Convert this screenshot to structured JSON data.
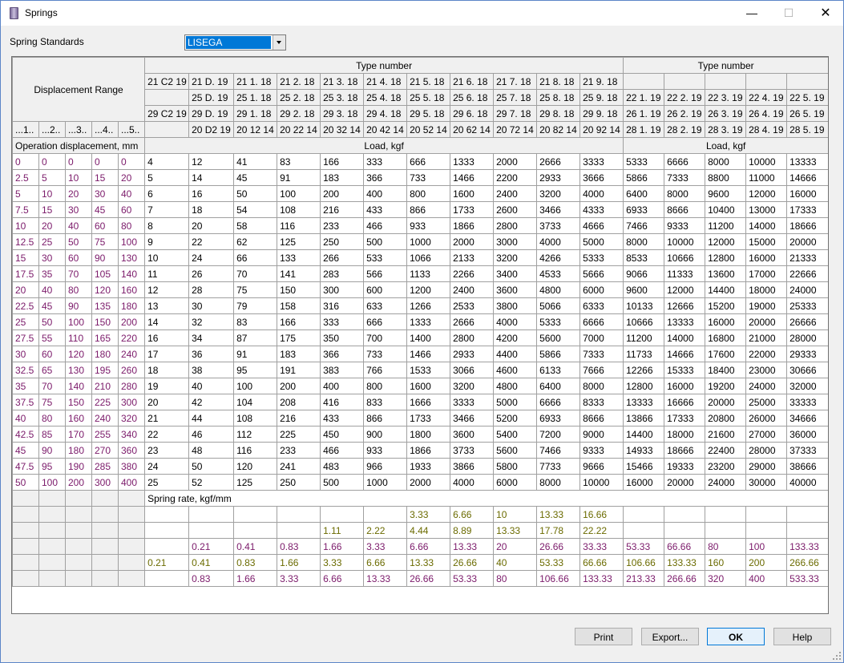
{
  "window": {
    "title": "Springs",
    "min": "—",
    "max": "☐",
    "close": "✕"
  },
  "standards": {
    "label": "Spring Standards",
    "value": "LISEGA"
  },
  "table": {
    "displacement_range": "Displacement Range",
    "type_number": "Type number",
    "op_disp": "Operation displacement, mm",
    "load": "Load, kgf",
    "spring_rate": "Spring rate, kgf/mm",
    "range_cols": [
      "...1..",
      "...2..",
      "...3..",
      "...4..",
      "...5.."
    ],
    "typerow1a": [
      "21 C2 19",
      "21 D. 19",
      "21 1. 18",
      "21 2. 18",
      "21 3. 18",
      "21 4. 18",
      "21 5. 18",
      "21 6. 18",
      "21 7. 18",
      "21 8. 18",
      "21 9. 18"
    ],
    "typerow2a": [
      "",
      "25 D. 19",
      "25 1. 18",
      "25 2. 18",
      "25 3. 18",
      "25 4. 18",
      "25 5. 18",
      "25 6. 18",
      "25 7. 18",
      "25 8. 18",
      "25 9. 18"
    ],
    "typerow3a": [
      "29 C2 19",
      "29 D. 19",
      "29 1. 18",
      "29 2. 18",
      "29 3. 18",
      "29 4. 18",
      "29 5. 18",
      "29 6. 18",
      "29 7. 18",
      "29 8. 18",
      "29 9. 18"
    ],
    "typerow4a": [
      "",
      "20 D2 19",
      "20 12 14",
      "20 22 14",
      "20 32 14",
      "20 42 14",
      "20 52 14",
      "20 62 14",
      "20 72 14",
      "20 82 14",
      "20 92 14"
    ],
    "typerow1b": [
      "",
      "",
      "",
      "",
      ""
    ],
    "typerow2b": [
      "22 1. 19",
      "22 2. 19",
      "22 3. 19",
      "22 4. 19",
      "22 5. 19"
    ],
    "typerow3b": [
      "26 1. 19",
      "26 2. 19",
      "26 3. 19",
      "26 4. 19",
      "26 5. 19"
    ],
    "typerow4b": [
      "28 1. 19",
      "28 2. 19",
      "28 3. 19",
      "28 4. 19",
      "28 5. 19"
    ],
    "rows": [
      {
        "d": [
          "0",
          "0",
          "0",
          "0",
          "0"
        ],
        "v": [
          "4",
          "12",
          "41",
          "83",
          "166",
          "333",
          "666",
          "1333",
          "2000",
          "2666",
          "3333",
          "5333",
          "6666",
          "8000",
          "10000",
          "13333"
        ]
      },
      {
        "d": [
          "2.5",
          "5",
          "10",
          "15",
          "20"
        ],
        "v": [
          "5",
          "14",
          "45",
          "91",
          "183",
          "366",
          "733",
          "1466",
          "2200",
          "2933",
          "3666",
          "5866",
          "7333",
          "8800",
          "11000",
          "14666"
        ]
      },
      {
        "d": [
          "5",
          "10",
          "20",
          "30",
          "40"
        ],
        "v": [
          "6",
          "16",
          "50",
          "100",
          "200",
          "400",
          "800",
          "1600",
          "2400",
          "3200",
          "4000",
          "6400",
          "8000",
          "9600",
          "12000",
          "16000"
        ]
      },
      {
        "d": [
          "7.5",
          "15",
          "30",
          "45",
          "60"
        ],
        "v": [
          "7",
          "18",
          "54",
          "108",
          "216",
          "433",
          "866",
          "1733",
          "2600",
          "3466",
          "4333",
          "6933",
          "8666",
          "10400",
          "13000",
          "17333"
        ]
      },
      {
        "d": [
          "10",
          "20",
          "40",
          "60",
          "80"
        ],
        "v": [
          "8",
          "20",
          "58",
          "116",
          "233",
          "466",
          "933",
          "1866",
          "2800",
          "3733",
          "4666",
          "7466",
          "9333",
          "11200",
          "14000",
          "18666"
        ]
      },
      {
        "d": [
          "12.5",
          "25",
          "50",
          "75",
          "100"
        ],
        "v": [
          "9",
          "22",
          "62",
          "125",
          "250",
          "500",
          "1000",
          "2000",
          "3000",
          "4000",
          "5000",
          "8000",
          "10000",
          "12000",
          "15000",
          "20000"
        ]
      },
      {
        "d": [
          "15",
          "30",
          "60",
          "90",
          "130"
        ],
        "v": [
          "10",
          "24",
          "66",
          "133",
          "266",
          "533",
          "1066",
          "2133",
          "3200",
          "4266",
          "5333",
          "8533",
          "10666",
          "12800",
          "16000",
          "21333"
        ]
      },
      {
        "d": [
          "17.5",
          "35",
          "70",
          "105",
          "140"
        ],
        "v": [
          "11",
          "26",
          "70",
          "141",
          "283",
          "566",
          "1133",
          "2266",
          "3400",
          "4533",
          "5666",
          "9066",
          "11333",
          "13600",
          "17000",
          "22666"
        ]
      },
      {
        "d": [
          "20",
          "40",
          "80",
          "120",
          "160"
        ],
        "v": [
          "12",
          "28",
          "75",
          "150",
          "300",
          "600",
          "1200",
          "2400",
          "3600",
          "4800",
          "6000",
          "9600",
          "12000",
          "14400",
          "18000",
          "24000"
        ]
      },
      {
        "d": [
          "22.5",
          "45",
          "90",
          "135",
          "180"
        ],
        "v": [
          "13",
          "30",
          "79",
          "158",
          "316",
          "633",
          "1266",
          "2533",
          "3800",
          "5066",
          "6333",
          "10133",
          "12666",
          "15200",
          "19000",
          "25333"
        ]
      },
      {
        "d": [
          "25",
          "50",
          "100",
          "150",
          "200"
        ],
        "v": [
          "14",
          "32",
          "83",
          "166",
          "333",
          "666",
          "1333",
          "2666",
          "4000",
          "5333",
          "6666",
          "10666",
          "13333",
          "16000",
          "20000",
          "26666"
        ]
      },
      {
        "d": [
          "27.5",
          "55",
          "110",
          "165",
          "220"
        ],
        "v": [
          "16",
          "34",
          "87",
          "175",
          "350",
          "700",
          "1400",
          "2800",
          "4200",
          "5600",
          "7000",
          "11200",
          "14000",
          "16800",
          "21000",
          "28000"
        ]
      },
      {
        "d": [
          "30",
          "60",
          "120",
          "180",
          "240"
        ],
        "v": [
          "17",
          "36",
          "91",
          "183",
          "366",
          "733",
          "1466",
          "2933",
          "4400",
          "5866",
          "7333",
          "11733",
          "14666",
          "17600",
          "22000",
          "29333"
        ]
      },
      {
        "d": [
          "32.5",
          "65",
          "130",
          "195",
          "260"
        ],
        "v": [
          "18",
          "38",
          "95",
          "191",
          "383",
          "766",
          "1533",
          "3066",
          "4600",
          "6133",
          "7666",
          "12266",
          "15333",
          "18400",
          "23000",
          "30666"
        ]
      },
      {
        "d": [
          "35",
          "70",
          "140",
          "210",
          "280"
        ],
        "v": [
          "19",
          "40",
          "100",
          "200",
          "400",
          "800",
          "1600",
          "3200",
          "4800",
          "6400",
          "8000",
          "12800",
          "16000",
          "19200",
          "24000",
          "32000"
        ]
      },
      {
        "d": [
          "37.5",
          "75",
          "150",
          "225",
          "300"
        ],
        "v": [
          "20",
          "42",
          "104",
          "208",
          "416",
          "833",
          "1666",
          "3333",
          "5000",
          "6666",
          "8333",
          "13333",
          "16666",
          "20000",
          "25000",
          "33333"
        ]
      },
      {
        "d": [
          "40",
          "80",
          "160",
          "240",
          "320"
        ],
        "v": [
          "21",
          "44",
          "108",
          "216",
          "433",
          "866",
          "1733",
          "3466",
          "5200",
          "6933",
          "8666",
          "13866",
          "17333",
          "20800",
          "26000",
          "34666"
        ]
      },
      {
        "d": [
          "42.5",
          "85",
          "170",
          "255",
          "340"
        ],
        "v": [
          "22",
          "46",
          "112",
          "225",
          "450",
          "900",
          "1800",
          "3600",
          "5400",
          "7200",
          "9000",
          "14400",
          "18000",
          "21600",
          "27000",
          "36000"
        ]
      },
      {
        "d": [
          "45",
          "90",
          "180",
          "270",
          "360"
        ],
        "v": [
          "23",
          "48",
          "116",
          "233",
          "466",
          "933",
          "1866",
          "3733",
          "5600",
          "7466",
          "9333",
          "14933",
          "18666",
          "22400",
          "28000",
          "37333"
        ]
      },
      {
        "d": [
          "47.5",
          "95",
          "190",
          "285",
          "380"
        ],
        "v": [
          "24",
          "50",
          "120",
          "241",
          "483",
          "966",
          "1933",
          "3866",
          "5800",
          "7733",
          "9666",
          "15466",
          "19333",
          "23200",
          "29000",
          "38666"
        ]
      },
      {
        "d": [
          "50",
          "100",
          "200",
          "300",
          "400"
        ],
        "v": [
          "25",
          "52",
          "125",
          "250",
          "500",
          "1000",
          "2000",
          "4000",
          "6000",
          "8000",
          "10000",
          "16000",
          "20000",
          "24000",
          "30000",
          "40000"
        ]
      }
    ],
    "rates": [
      {
        "c": "ol",
        "v": [
          "",
          "",
          "",
          "",
          "",
          "",
          "3.33",
          "6.66",
          "10",
          "13.33",
          "16.66",
          "",
          "",
          "",
          "",
          ""
        ]
      },
      {
        "c": "ol",
        "v": [
          "",
          "",
          "",
          "",
          "1.11",
          "2.22",
          "4.44",
          "8.89",
          "13.33",
          "17.78",
          "22.22",
          "",
          "",
          "",
          "",
          ""
        ]
      },
      {
        "c": "disp",
        "v": [
          "",
          "0.21",
          "0.41",
          "0.83",
          "1.66",
          "3.33",
          "6.66",
          "13.33",
          "20",
          "26.66",
          "33.33",
          "53.33",
          "66.66",
          "80",
          "100",
          "133.33"
        ]
      },
      {
        "c": "ol",
        "v": [
          "0.21",
          "0.41",
          "0.83",
          "1.66",
          "3.33",
          "6.66",
          "13.33",
          "26.66",
          "40",
          "53.33",
          "66.66",
          "106.66",
          "133.33",
          "160",
          "200",
          "266.66"
        ]
      },
      {
        "c": "disp",
        "v": [
          "",
          "0.83",
          "1.66",
          "3.33",
          "6.66",
          "13.33",
          "26.66",
          "53.33",
          "80",
          "106.66",
          "133.33",
          "213.33",
          "266.66",
          "320",
          "400",
          "533.33"
        ]
      }
    ]
  },
  "buttons": {
    "print": "Print",
    "export": "Export...",
    "ok": "OK",
    "help": "Help"
  }
}
